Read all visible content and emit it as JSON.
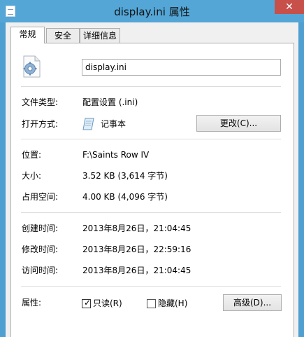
{
  "window": {
    "title": "display.ini 属性",
    "close_glyph": "✕"
  },
  "tabs": [
    {
      "label": "常规",
      "active": true
    },
    {
      "label": "安全",
      "active": false
    },
    {
      "label": "详细信息",
      "active": false
    }
  ],
  "file": {
    "name": "display.ini"
  },
  "type": {
    "label": "文件类型:",
    "value": "配置设置 (.ini)"
  },
  "opens_with": {
    "label": "打开方式:",
    "value": "记事本",
    "button": "更改(C)..."
  },
  "location": {
    "label": "位置:",
    "value": "F:\\Saints Row IV"
  },
  "size": {
    "label": "大小:",
    "value": "3.52 KB (3,614 字节)"
  },
  "size_on_disk": {
    "label": "占用空间:",
    "value": "4.00 KB (4,096 字节)"
  },
  "created": {
    "label": "创建时间:",
    "value": "2013年8月26日，21:04:45"
  },
  "modified": {
    "label": "修改时间:",
    "value": "2013年8月26日，22:59:16"
  },
  "accessed": {
    "label": "访问时间:",
    "value": "2013年8月26日，21:04:45"
  },
  "attributes": {
    "label": "属性:",
    "readonly": {
      "label": "只读(R)",
      "checked": true,
      "mark": "✓"
    },
    "hidden": {
      "label": "隐藏(H)",
      "checked": false
    },
    "advanced_button": "高级(D)..."
  },
  "icons": {
    "app": "ini-file-icon",
    "file": "settings-file-icon",
    "opener": "notepad-icon"
  },
  "colors": {
    "titlebar": "#53a6d6",
    "close": "#c7504a",
    "panel": "#ffffff"
  }
}
